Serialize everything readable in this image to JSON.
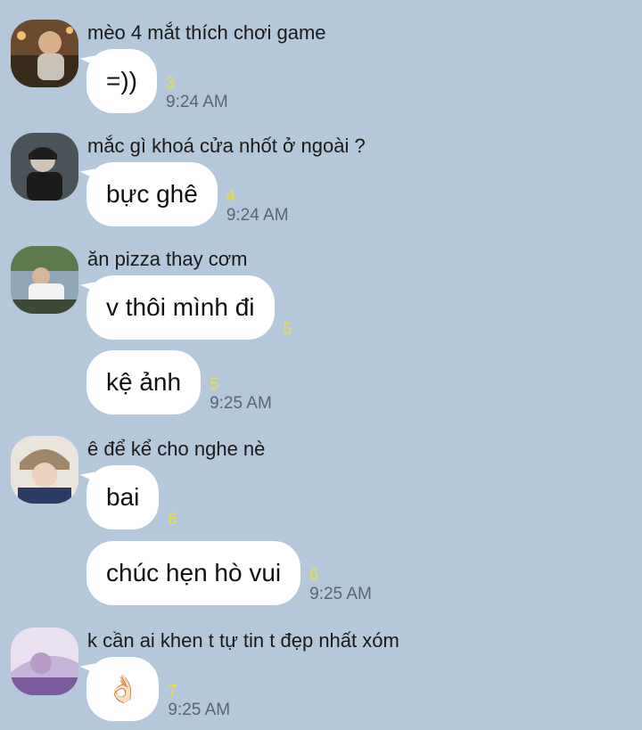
{
  "groups": [
    {
      "sender": "mèo 4 mắt thích chơi game",
      "messages": [
        {
          "text": "=))",
          "read": "3",
          "time": "9:24 AM"
        }
      ]
    },
    {
      "sender": "mắc gì khoá cửa nhốt ở ngoài ?",
      "messages": [
        {
          "text": "bực ghê",
          "read": "4",
          "time": "9:24 AM"
        }
      ]
    },
    {
      "sender": "ăn pizza thay cơm",
      "messages": [
        {
          "text": "v thôi mình đi",
          "read": "5",
          "time": ""
        },
        {
          "text": "kệ ảnh",
          "read": "5",
          "time": "9:25 AM"
        }
      ]
    },
    {
      "sender": "ê để kể cho nghe nè",
      "messages": [
        {
          "text": "bai",
          "read": "6",
          "time": ""
        },
        {
          "text": "chúc hẹn hò vui",
          "read": "6",
          "time": "9:25 AM"
        }
      ]
    },
    {
      "sender": "k cần ai khen t tự tin t đẹp nhất xóm",
      "messages": [
        {
          "text": "👌🏻",
          "read": "7",
          "time": "9:25 AM"
        }
      ]
    }
  ]
}
